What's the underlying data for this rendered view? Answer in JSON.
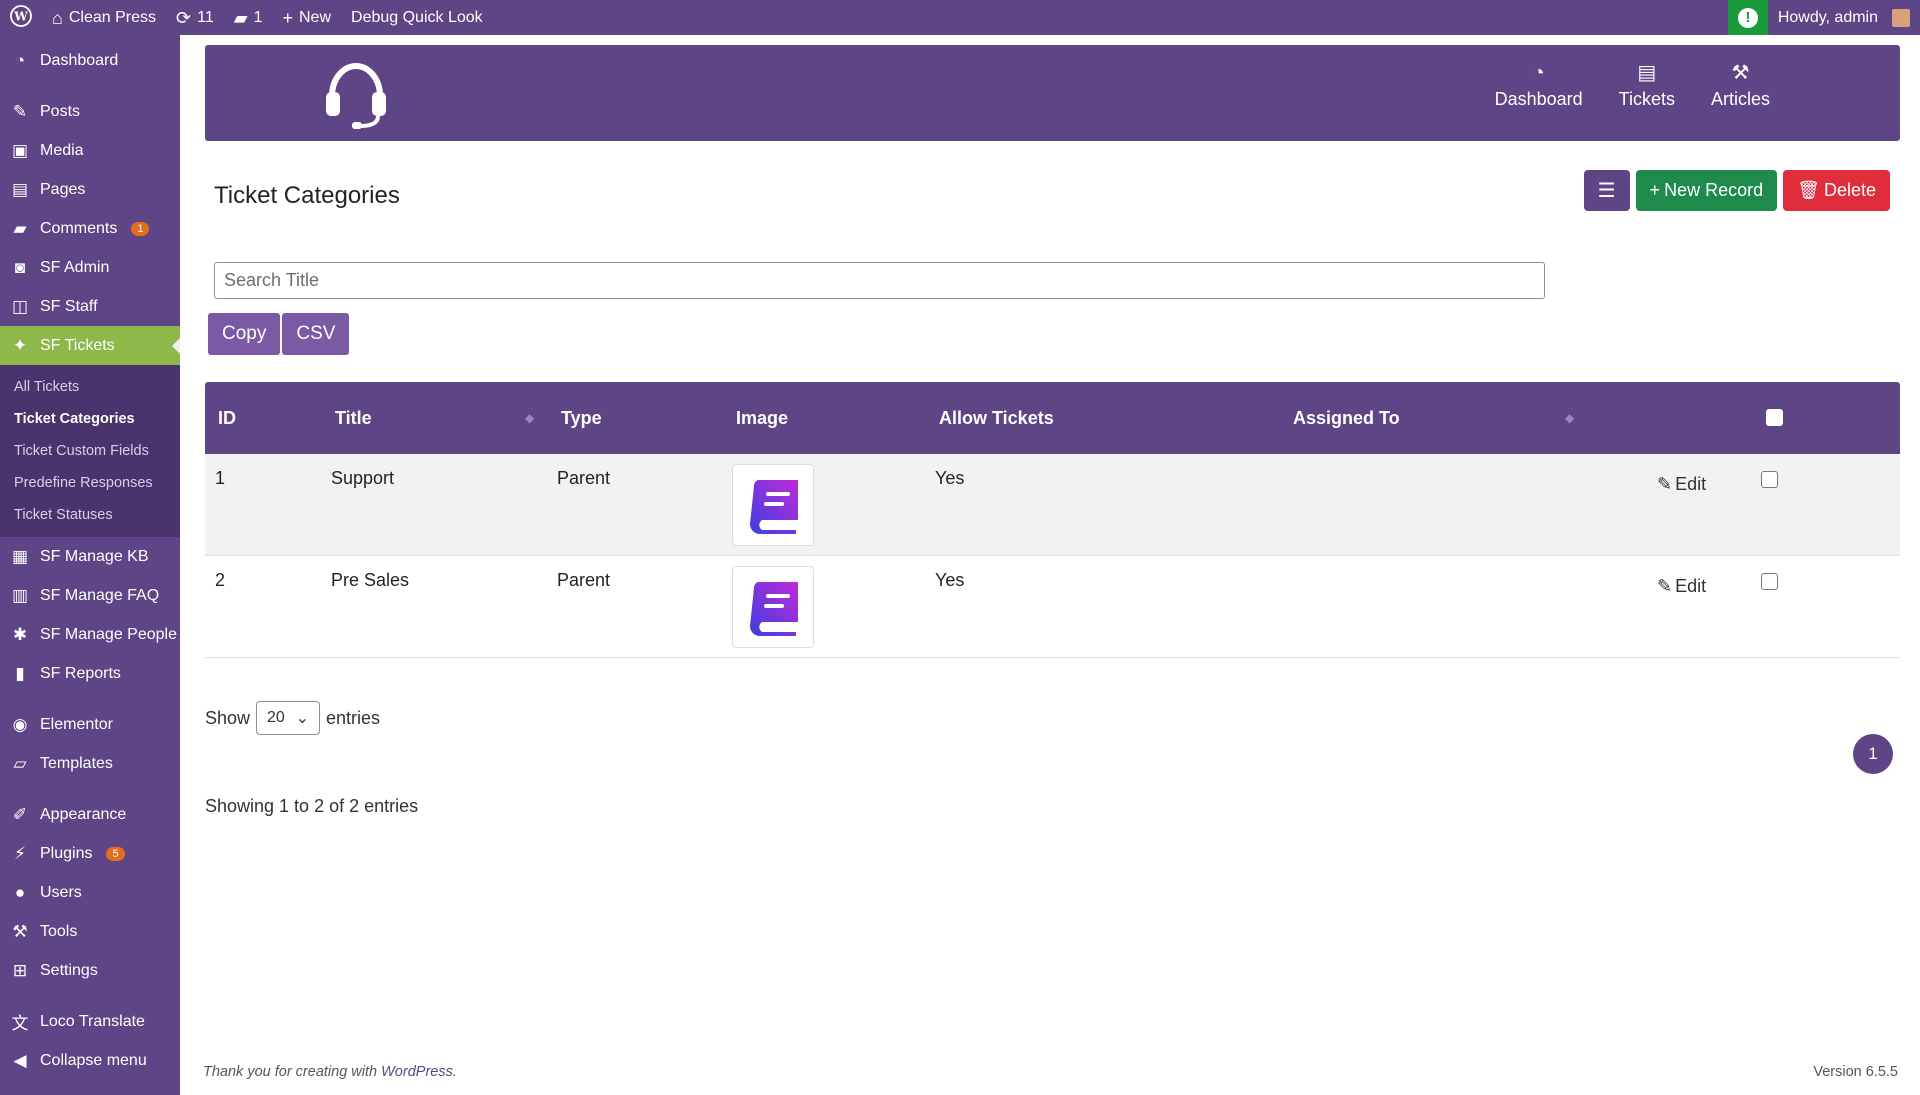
{
  "adminbar": {
    "site_name": "Clean Press",
    "updates_count": "11",
    "comments_count": "1",
    "new_label": "New",
    "debug_label": "Debug Quick Look",
    "howdy": "Howdy, admin"
  },
  "sidebar": {
    "dashboard": "Dashboard",
    "posts": "Posts",
    "media": "Media",
    "pages": "Pages",
    "comments": "Comments",
    "comments_badge": "1",
    "sf_admin": "SF Admin",
    "sf_staff": "SF Staff",
    "sf_tickets": "SF Tickets",
    "sub": {
      "all_tickets": "All Tickets",
      "ticket_categories": "Ticket Categories",
      "ticket_custom_fields": "Ticket Custom Fields",
      "predefine_responses": "Predefine Responses",
      "ticket_statuses": "Ticket Statuses"
    },
    "sf_manage_kb": "SF Manage KB",
    "sf_manage_faq": "SF Manage FAQ",
    "sf_manage_people": "SF Manage People",
    "sf_reports": "SF Reports",
    "elementor": "Elementor",
    "templates": "Templates",
    "appearance": "Appearance",
    "plugins": "Plugins",
    "plugins_badge": "5",
    "users": "Users",
    "tools": "Tools",
    "settings": "Settings",
    "loco_translate": "Loco Translate",
    "collapse": "Collapse menu"
  },
  "topnav": {
    "dashboard": "Dashboard",
    "tickets": "Tickets",
    "articles": "Articles"
  },
  "page": {
    "title": "Ticket Categories",
    "new_record": "New Record",
    "delete": "Delete",
    "search_placeholder": "Search Title",
    "copy": "Copy",
    "csv": "CSV"
  },
  "table": {
    "headers": {
      "id": "ID",
      "title": "Title",
      "type": "Type",
      "image": "Image",
      "allow_tickets": "Allow Tickets",
      "assigned_to": "Assigned To"
    },
    "rows": [
      {
        "id": "1",
        "title": "Support",
        "type": "Parent",
        "allow": "Yes",
        "assigned": "",
        "edit": "Edit"
      },
      {
        "id": "2",
        "title": "Pre Sales",
        "type": "Parent",
        "allow": "Yes",
        "assigned": "",
        "edit": "Edit"
      }
    ]
  },
  "footer_table": {
    "show": "Show",
    "entries_value": "20",
    "entries": "entries",
    "page": "1",
    "info": "Showing 1 to 2 of 2 entries"
  },
  "footer": {
    "thanks": "Thank you for creating with ",
    "wp_link": "WordPress",
    "period": ".",
    "version": "Version 6.5.5"
  },
  "colors": {
    "brand": "#5e4585",
    "active_menu": "#8fb84a",
    "success": "#1e8a4b",
    "danger": "#e02d3c"
  }
}
